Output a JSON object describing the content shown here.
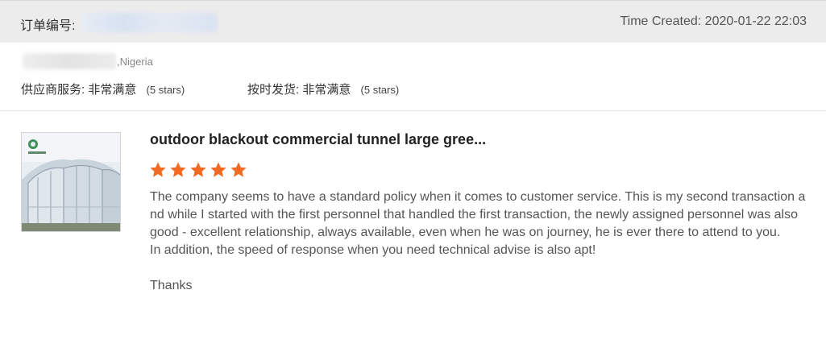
{
  "order": {
    "label": "订单编号:",
    "time_created": "Time Created: 2020-01-22 22:03"
  },
  "buyer": {
    "country": ",Nigeria"
  },
  "ratings": {
    "supplier_service": {
      "label": "供应商服务:",
      "value": "非常满意",
      "stars_text": "(5 stars)"
    },
    "on_time_delivery": {
      "label": "按时发货:",
      "value": "非常满意",
      "stars_text": "(5 stars)"
    }
  },
  "review": {
    "product_title": "outdoor blackout commercial tunnel large gree...",
    "rating": 5,
    "star_icon": "star-icon",
    "star_color": "#f26a21",
    "paragraphs": [
      "The company seems to have a standard policy when it comes to customer service. This is my second transaction and while I started with the first personnel that handled the first transaction, the newly assigned personnel was also good - excellent relationship, always available, even when he was on journey, he is ever there to attend to you.",
      "In addition, the speed of response when you need technical advise is also apt!",
      "Thanks"
    ]
  },
  "colors": {
    "header_bg": "#ececec",
    "accent_star": "#f26a21",
    "divider": "#e2e2e2"
  }
}
